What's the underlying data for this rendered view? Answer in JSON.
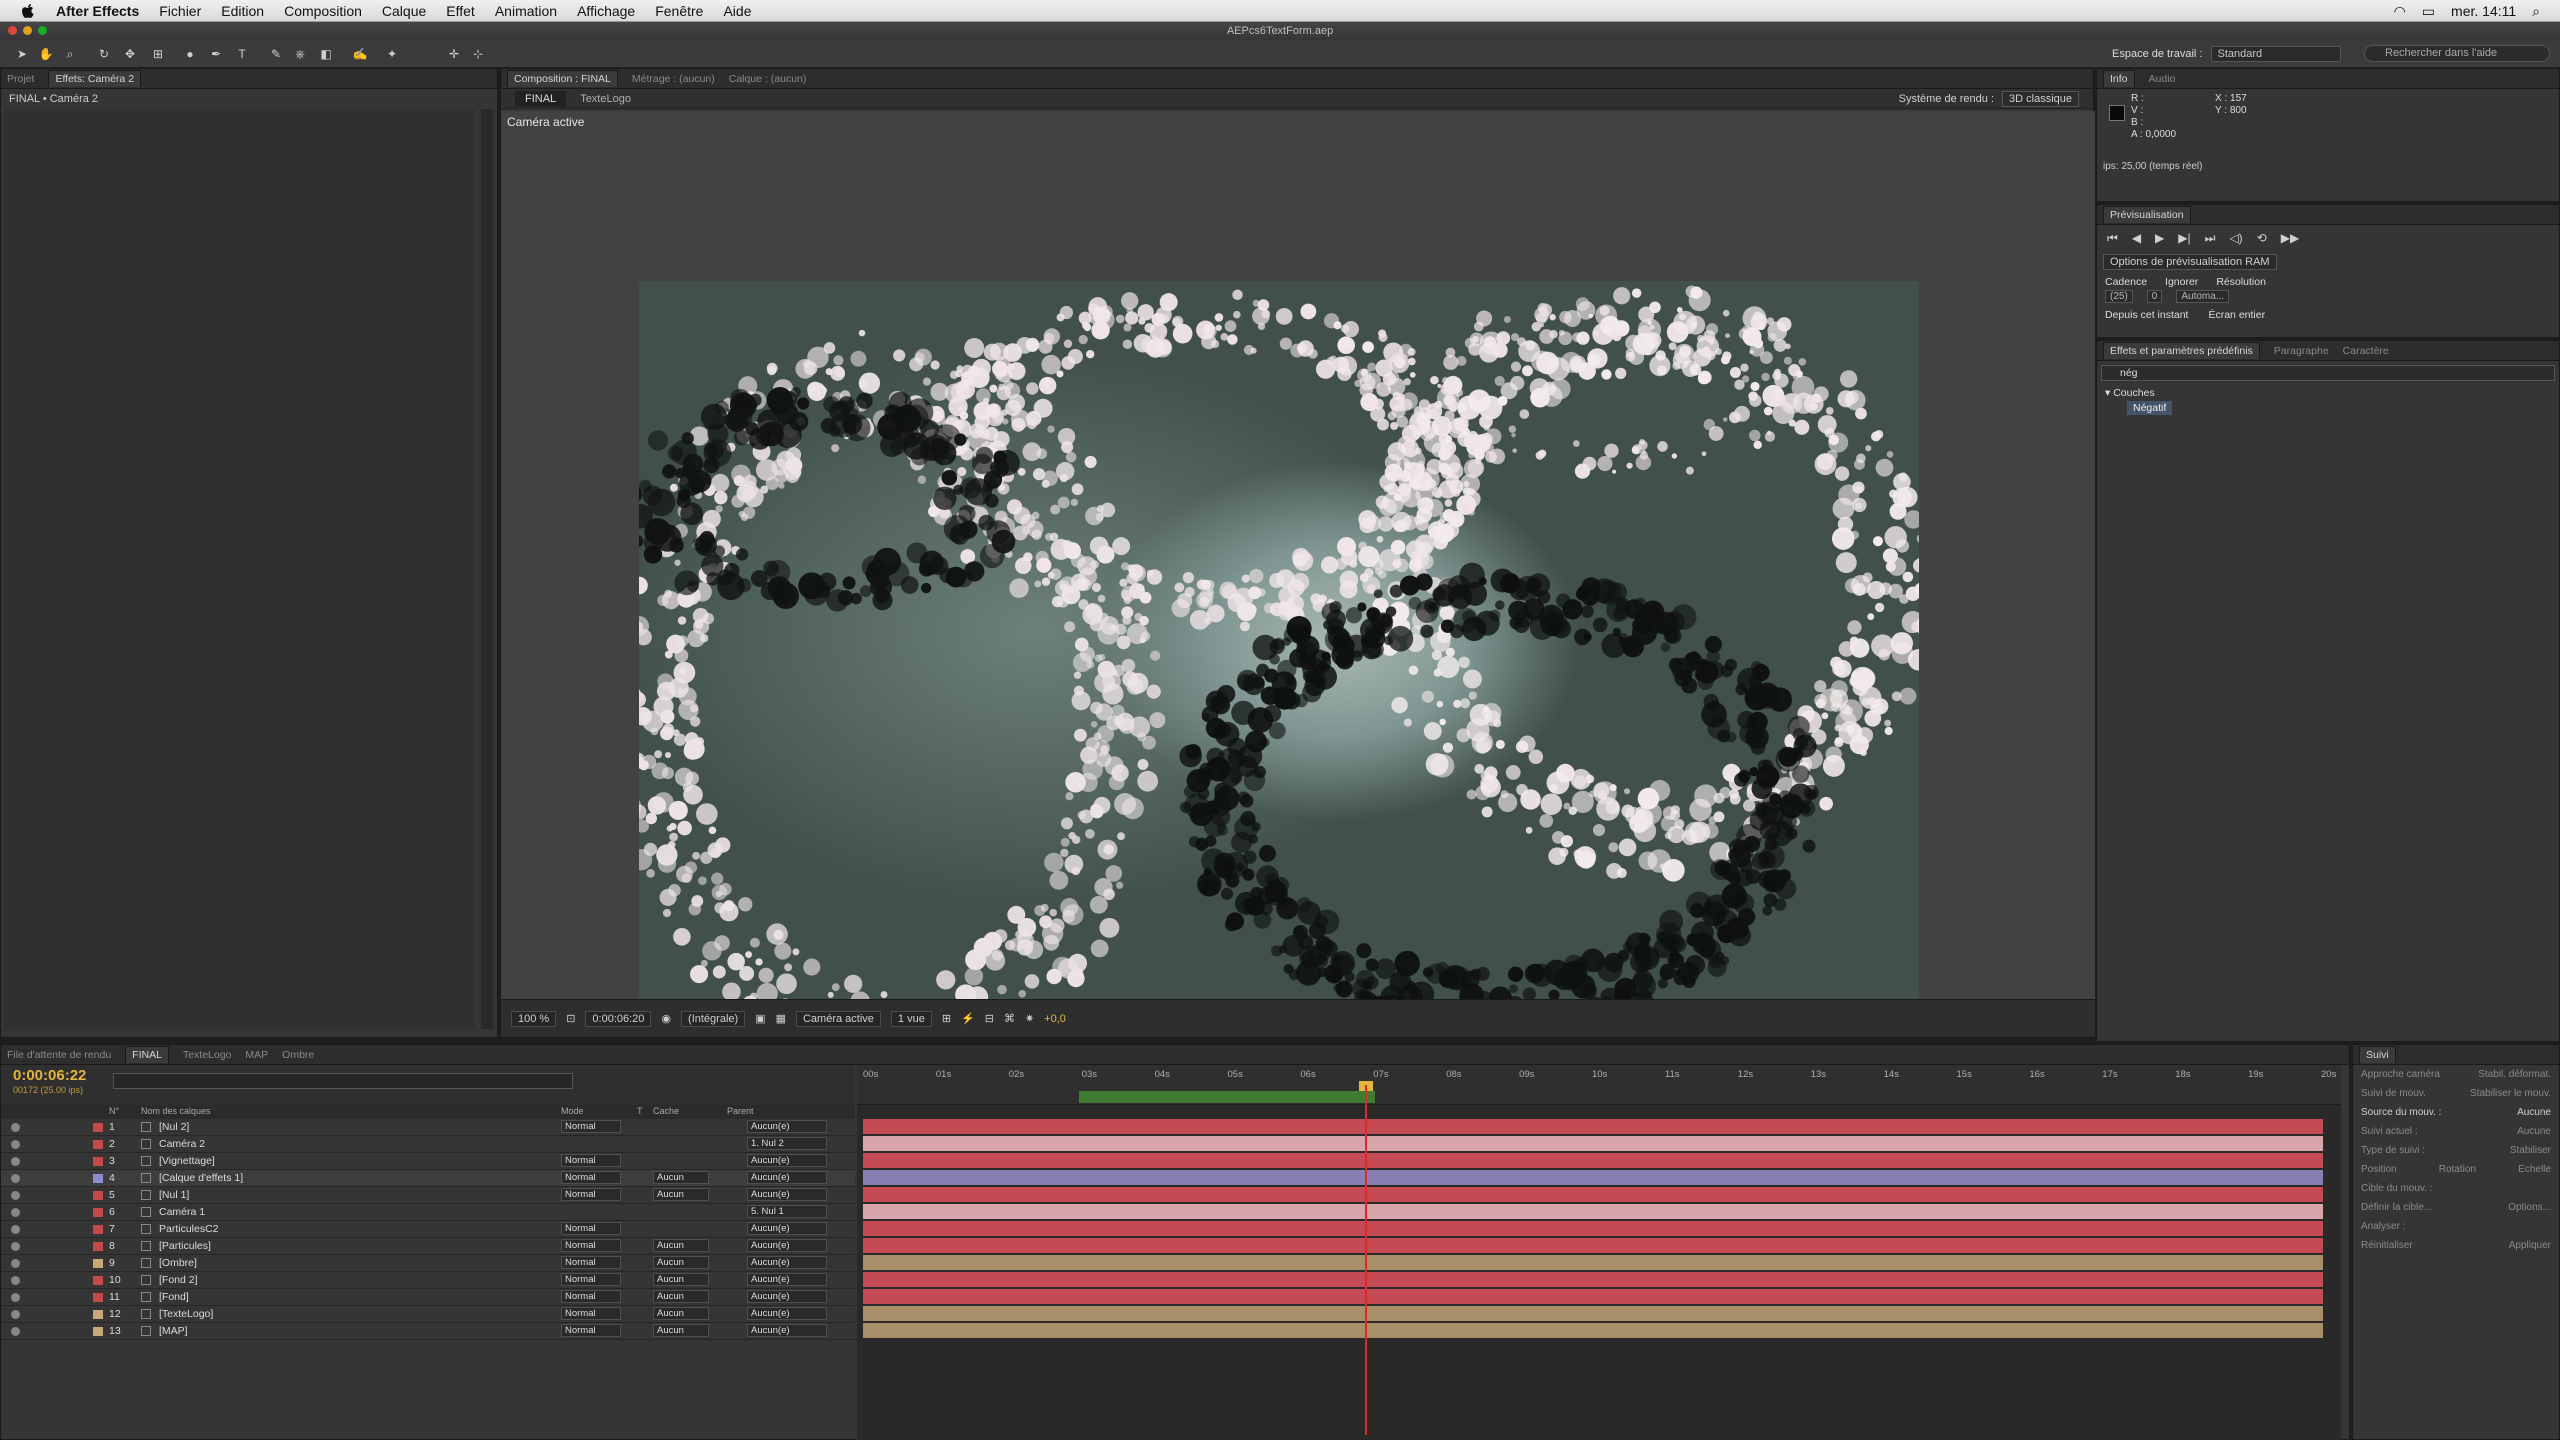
{
  "menubar": {
    "app": "After Effects",
    "items": [
      "Fichier",
      "Edition",
      "Composition",
      "Calque",
      "Effet",
      "Animation",
      "Affichage",
      "Fenêtre",
      "Aide"
    ],
    "clock": "mer. 14:11"
  },
  "window": {
    "title": "AEPcs6TextForm.aep"
  },
  "toolbar": {
    "workspace_label": "Espace de travail :",
    "workspace_value": "Standard",
    "search_placeholder": "Rechercher dans l'aide"
  },
  "project_panel": {
    "tabs": [
      "Projet",
      "Effets: Caméra 2"
    ],
    "breadcrumb": "FINAL • Caméra 2"
  },
  "comp_panel": {
    "tabs": [
      "Composition : FINAL",
      "Métrage : (aucun)",
      "Calque : (aucun)"
    ],
    "subtabs": [
      "FINAL",
      "TexteLogo"
    ],
    "renderer_label": "Système de rendu :",
    "renderer_value": "3D classique",
    "camera_label": "Caméra active",
    "bottom": {
      "zoom": "100 %",
      "timecode": "0:00:06:20",
      "resolution": "(Intégrale)",
      "view": "Caméra active",
      "views": "1 vue",
      "exposure": "+0,0"
    }
  },
  "info_panel": {
    "tabs": [
      "Info",
      "Audio"
    ],
    "r": "R :",
    "v": "V :",
    "b": "B :",
    "a": "A : 0,0000",
    "x": "X : 157",
    "y": "Y : 800",
    "fps": "ips: 25,00 (temps réel)"
  },
  "preview_panel": {
    "tab": "Prévisualisation",
    "ram_options": "Options de prévisualisation RAM",
    "labels": [
      "Cadence",
      "Ignorer",
      "Résolution"
    ],
    "values": [
      "(25)",
      "0",
      "Automa..."
    ],
    "checks": [
      "Depuis cet instant",
      "Écran entier"
    ]
  },
  "effects_panel": {
    "tabs": [
      "Effets et paramètres prédéfinis",
      "Paragraphe",
      "Caractère"
    ],
    "search": "nég",
    "category": "Couches",
    "result": "Négatif"
  },
  "timeline": {
    "tabs": [
      "File d'attente de rendu",
      "FINAL",
      "TexteLogo",
      "MAP",
      "Ombre"
    ],
    "timecode": "0:00:06:22",
    "frames": "00172 (25.00 ips)",
    "col_headers": [
      "N°",
      "Nom des calques",
      "Mode",
      "T",
      "Cache",
      "Parent"
    ],
    "ruler_ticks": [
      "00s",
      "01s",
      "02s",
      "03s",
      "04s",
      "05s",
      "06s",
      "07s",
      "08s",
      "09s",
      "10s",
      "11s",
      "12s",
      "13s",
      "14s",
      "15s",
      "16s",
      "17s",
      "18s",
      "19s",
      "20s"
    ],
    "layers": [
      {
        "n": "1",
        "name": "[Nul 2]",
        "mode": "Normal",
        "cache": "",
        "parent": "Aucun(e)",
        "color": "#c44a4a",
        "bar": "#c44a55"
      },
      {
        "n": "2",
        "name": "Caméra 2",
        "mode": "",
        "cache": "",
        "parent": "1. Nul 2",
        "color": "#c44a4a",
        "bar": "#d9a5ad"
      },
      {
        "n": "3",
        "name": "[Vignettage]",
        "mode": "Normal",
        "cache": "",
        "parent": "Aucun(e)",
        "color": "#c44a4a",
        "bar": "#c44a55"
      },
      {
        "n": "4",
        "name": "[Calque d'effets 1]",
        "mode": "Normal",
        "cache": "Aucun",
        "parent": "Aucun(e)",
        "color": "#8b8bd0",
        "bar": "#8a7fb3"
      },
      {
        "n": "5",
        "name": "[Nul 1]",
        "mode": "Normal",
        "cache": "Aucun",
        "parent": "Aucun(e)",
        "color": "#c44a4a",
        "bar": "#c44a55"
      },
      {
        "n": "6",
        "name": "Caméra 1",
        "mode": "",
        "cache": "",
        "parent": "5. Nul 1",
        "color": "#c44a4a",
        "bar": "#d9a5ad"
      },
      {
        "n": "7",
        "name": "ParticulesC2",
        "mode": "Normal",
        "cache": "",
        "parent": "Aucun(e)",
        "color": "#c44a4a",
        "bar": "#c44a55"
      },
      {
        "n": "8",
        "name": "[Particules]",
        "mode": "Normal",
        "cache": "Aucun",
        "parent": "Aucun(e)",
        "color": "#c44a4a",
        "bar": "#c44a55"
      },
      {
        "n": "9",
        "name": "[Ombre]",
        "mode": "Normal",
        "cache": "Aucun",
        "parent": "Aucun(e)",
        "color": "#c8a878",
        "bar": "#a88f6a"
      },
      {
        "n": "10",
        "name": "[Fond 2]",
        "mode": "Normal",
        "cache": "Aucun",
        "parent": "Aucun(e)",
        "color": "#c44a4a",
        "bar": "#c44a55"
      },
      {
        "n": "11",
        "name": "[Fond]",
        "mode": "Normal",
        "cache": "Aucun",
        "parent": "Aucun(e)",
        "color": "#c44a4a",
        "bar": "#c44a55"
      },
      {
        "n": "12",
        "name": "[TexteLogo]",
        "mode": "Normal",
        "cache": "Aucun",
        "parent": "Aucun(e)",
        "color": "#c8a878",
        "bar": "#a88f6a"
      },
      {
        "n": "13",
        "name": "[MAP]",
        "mode": "Normal",
        "cache": "Aucun",
        "parent": "Aucun(e)",
        "color": "#c8a878",
        "bar": "#a88f6a"
      }
    ]
  },
  "suivi_panel": {
    "tab": "Suivi",
    "rows": [
      [
        "Approche caméra",
        "Stabil. déformat."
      ],
      [
        "Suivi de mouv.",
        "Stabiliser le mouv."
      ],
      [
        "Source du mouv. :",
        "Aucune"
      ],
      [
        "Suivi actuel :",
        "Aucune"
      ],
      [
        "Type de suivi :",
        "Stabiliser"
      ],
      [
        "Position",
        "Rotation",
        "Echelle"
      ],
      [
        "Cible du mouv. :",
        ""
      ],
      [
        "Définir la cible...",
        "Options..."
      ],
      [
        "Analyser :",
        ""
      ],
      [
        "Réinitialiser",
        "Appliquer"
      ]
    ]
  },
  "colors": {
    "accent_timecode": "#e3b43f",
    "workarea": "#3f7b33",
    "playhead": "#e02828"
  }
}
